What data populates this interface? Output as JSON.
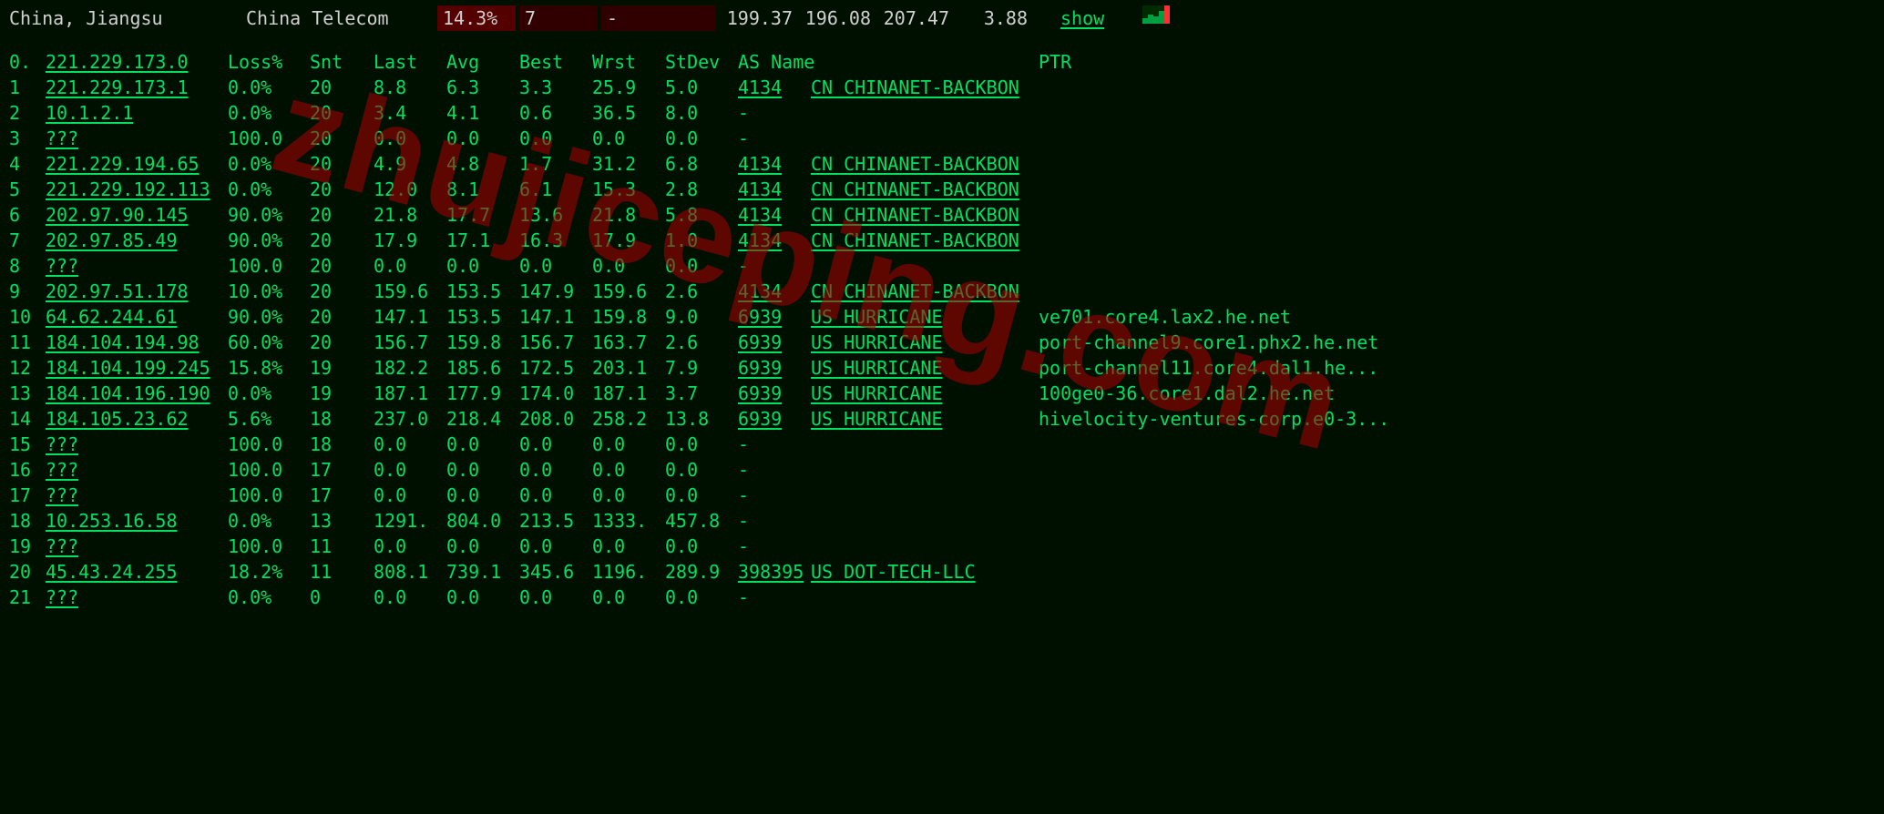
{
  "header": {
    "location": "China, Jiangsu",
    "isp": "China Telecom",
    "loss": "14.3%",
    "count": "7",
    "dash": "-",
    "avg": "199.37",
    "best": "196.08",
    "wrst": "207.47",
    "stdev": "3.88",
    "show": "show"
  },
  "columns": {
    "idx": "0.",
    "ip": "221.229.173.0",
    "loss": "Loss%",
    "snt": "Snt",
    "last": "Last",
    "avg": "Avg",
    "best": "Best",
    "wrst": "Wrst",
    "stdev": "StDev",
    "asname": "AS Name",
    "ptr": "PTR"
  },
  "hops": [
    {
      "idx": "1",
      "ip": "221.229.173.1",
      "loss": "0.0%",
      "snt": "20",
      "last": "8.8",
      "avg": "6.3",
      "best": "3.3",
      "wrst": "25.9",
      "stdev": "5.0",
      "as": "4134",
      "asn": "CN CHINANET-BACKBON",
      "asU": true,
      "ptr": ""
    },
    {
      "idx": "2",
      "ip": "10.1.2.1",
      "loss": "0.0%",
      "snt": "20",
      "last": "3.4",
      "avg": "4.1",
      "best": "0.6",
      "wrst": "36.5",
      "stdev": "8.0",
      "as": "-",
      "asn": "",
      "asU": false,
      "ptr": ""
    },
    {
      "idx": "3",
      "ip": "???",
      "loss": "100.0",
      "snt": "20",
      "last": "0.0",
      "avg": "0.0",
      "best": "0.0",
      "wrst": "0.0",
      "stdev": "0.0",
      "as": "-",
      "asn": "",
      "asU": false,
      "ptr": ""
    },
    {
      "idx": "4",
      "ip": "221.229.194.65",
      "loss": "0.0%",
      "snt": "20",
      "last": "4.9",
      "avg": "4.8",
      "best": "1.7",
      "wrst": "31.2",
      "stdev": "6.8",
      "as": "4134",
      "asn": "CN CHINANET-BACKBON",
      "asU": true,
      "ptr": ""
    },
    {
      "idx": "5",
      "ip": "221.229.192.113",
      "loss": "0.0%",
      "snt": "20",
      "last": "12.0",
      "avg": "8.1",
      "best": "6.1",
      "wrst": "15.3",
      "stdev": "2.8",
      "as": "4134",
      "asn": "CN CHINANET-BACKBON",
      "asU": true,
      "ptr": ""
    },
    {
      "idx": "6",
      "ip": "202.97.90.145",
      "loss": "90.0%",
      "snt": "20",
      "last": "21.8",
      "avg": "17.7",
      "best": "13.6",
      "wrst": "21.8",
      "stdev": "5.8",
      "as": "4134",
      "asn": "CN CHINANET-BACKBON",
      "asU": true,
      "ptr": ""
    },
    {
      "idx": "7",
      "ip": "202.97.85.49",
      "loss": "90.0%",
      "snt": "20",
      "last": "17.9",
      "avg": "17.1",
      "best": "16.3",
      "wrst": "17.9",
      "stdev": "1.0",
      "as": "4134",
      "asn": "CN CHINANET-BACKBON",
      "asU": true,
      "ptr": ""
    },
    {
      "idx": "8",
      "ip": "???",
      "loss": "100.0",
      "snt": "20",
      "last": "0.0",
      "avg": "0.0",
      "best": "0.0",
      "wrst": "0.0",
      "stdev": "0.0",
      "as": "-",
      "asn": "",
      "asU": false,
      "ptr": ""
    },
    {
      "idx": "9",
      "ip": "202.97.51.178",
      "loss": "10.0%",
      "snt": "20",
      "last": "159.6",
      "avg": "153.5",
      "best": "147.9",
      "wrst": "159.6",
      "stdev": "2.6",
      "as": "4134",
      "asn": "CN CHINANET-BACKBON",
      "asU": true,
      "ptr": ""
    },
    {
      "idx": "10",
      "ip": "64.62.244.61",
      "loss": "90.0%",
      "snt": "20",
      "last": "147.1",
      "avg": "153.5",
      "best": "147.1",
      "wrst": "159.8",
      "stdev": "9.0",
      "as": "6939",
      "asn": "US HURRICANE",
      "asU": true,
      "ptr": "ve701.core4.lax2.he.net"
    },
    {
      "idx": "11",
      "ip": "184.104.194.98",
      "loss": "60.0%",
      "snt": "20",
      "last": "156.7",
      "avg": "159.8",
      "best": "156.7",
      "wrst": "163.7",
      "stdev": "2.6",
      "as": "6939",
      "asn": "US HURRICANE",
      "asU": true,
      "ptr": "port-channel9.core1.phx2.he.net"
    },
    {
      "idx": "12",
      "ip": "184.104.199.245",
      "loss": "15.8%",
      "snt": "19",
      "last": "182.2",
      "avg": "185.6",
      "best": "172.5",
      "wrst": "203.1",
      "stdev": "7.9",
      "as": "6939",
      "asn": "US HURRICANE",
      "asU": true,
      "ptr": "port-channel11.core4.dal1.he..."
    },
    {
      "idx": "13",
      "ip": "184.104.196.190",
      "loss": "0.0%",
      "snt": "19",
      "last": "187.1",
      "avg": "177.9",
      "best": "174.0",
      "wrst": "187.1",
      "stdev": "3.7",
      "as": "6939",
      "asn": "US HURRICANE",
      "asU": true,
      "ptr": "100ge0-36.core1.dal2.he.net"
    },
    {
      "idx": "14",
      "ip": "184.105.23.62",
      "loss": "5.6%",
      "snt": "18",
      "last": "237.0",
      "avg": "218.4",
      "best": "208.0",
      "wrst": "258.2",
      "stdev": "13.8",
      "as": "6939",
      "asn": "US HURRICANE",
      "asU": true,
      "ptr": "hivelocity-ventures-corp.e0-3..."
    },
    {
      "idx": "15",
      "ip": "???",
      "loss": "100.0",
      "snt": "18",
      "last": "0.0",
      "avg": "0.0",
      "best": "0.0",
      "wrst": "0.0",
      "stdev": "0.0",
      "as": "-",
      "asn": "",
      "asU": false,
      "ptr": ""
    },
    {
      "idx": "16",
      "ip": "???",
      "loss": "100.0",
      "snt": "17",
      "last": "0.0",
      "avg": "0.0",
      "best": "0.0",
      "wrst": "0.0",
      "stdev": "0.0",
      "as": "-",
      "asn": "",
      "asU": false,
      "ptr": ""
    },
    {
      "idx": "17",
      "ip": "???",
      "loss": "100.0",
      "snt": "17",
      "last": "0.0",
      "avg": "0.0",
      "best": "0.0",
      "wrst": "0.0",
      "stdev": "0.0",
      "as": "-",
      "asn": "",
      "asU": false,
      "ptr": ""
    },
    {
      "idx": "18",
      "ip": "10.253.16.58",
      "loss": "0.0%",
      "snt": "13",
      "last": "1291.",
      "avg": "804.0",
      "best": "213.5",
      "wrst": "1333.",
      "stdev": "457.8",
      "as": "-",
      "asn": "",
      "asU": false,
      "ptr": ""
    },
    {
      "idx": "19",
      "ip": "???",
      "loss": "100.0",
      "snt": "11",
      "last": "0.0",
      "avg": "0.0",
      "best": "0.0",
      "wrst": "0.0",
      "stdev": "0.0",
      "as": "-",
      "asn": "",
      "asU": false,
      "ptr": ""
    },
    {
      "idx": "20",
      "ip": "45.43.24.255",
      "loss": "18.2%",
      "snt": "11",
      "last": "808.1",
      "avg": "739.1",
      "best": "345.6",
      "wrst": "1196.",
      "stdev": "289.9",
      "as": "398395",
      "asn": "US DOT-TECH-LLC",
      "asU": true,
      "ptr": ""
    },
    {
      "idx": "21",
      "ip": "???",
      "loss": "0.0%",
      "snt": "0",
      "last": "0.0",
      "avg": "0.0",
      "best": "0.0",
      "wrst": "0.0",
      "stdev": "0.0",
      "as": "-",
      "asn": "",
      "asU": false,
      "ptr": ""
    }
  ],
  "watermark": "zhujiceping.com"
}
